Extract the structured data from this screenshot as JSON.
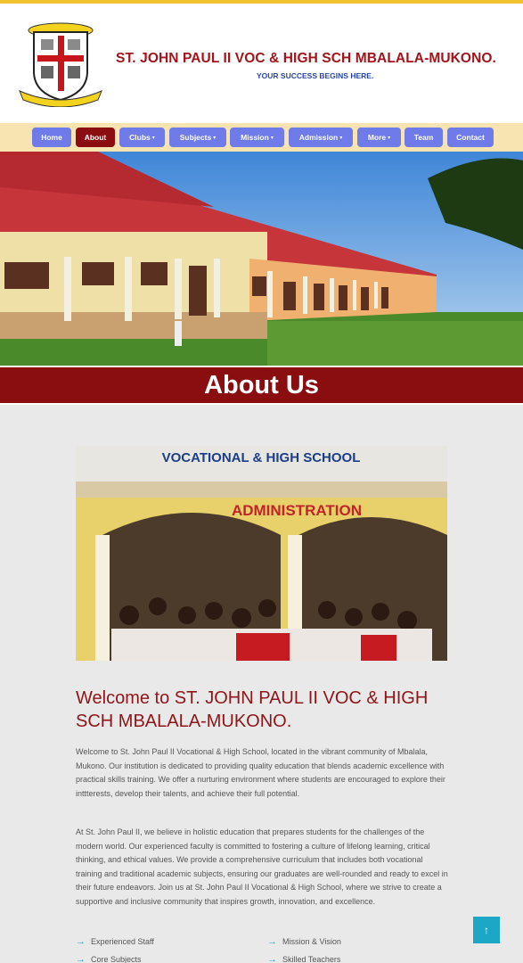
{
  "header": {
    "school_name": "ST. JOHN PAUL II VOC & HIGH SCH MBALALA-MUKONO.",
    "tagline": "YOUR SUCCESS BEGINS HERE.",
    "logo_icon": "school-crest-icon"
  },
  "nav": {
    "items": [
      {
        "label": "Home",
        "dropdown": false
      },
      {
        "label": "About",
        "dropdown": false,
        "active": true
      },
      {
        "label": "Clubs",
        "dropdown": true
      },
      {
        "label": "Subjects",
        "dropdown": true
      },
      {
        "label": "Mission",
        "dropdown": true
      },
      {
        "label": "Admission",
        "dropdown": true
      },
      {
        "label": "More",
        "dropdown": true
      },
      {
        "label": "Team",
        "dropdown": false
      },
      {
        "label": "Contact",
        "dropdown": false
      }
    ],
    "caret": "▾"
  },
  "about_band": {
    "title": "About Us"
  },
  "photo": {
    "sign_top": "VOCATIONAL & HIGH SCHOOL",
    "sign_bottom": "ADMINISTRATION"
  },
  "main": {
    "welcome_title": "Welcome to ST. JOHN PAUL II VOC & HIGH SCH MBALALA-MUKONO.",
    "paragraph1": "Welcome to St. John Paul II Vocational & High School, located in the vibrant community of Mbalala, Mukono. Our institution is dedicated to providing quality education that blends academic excellence with practical skills training. We offer a nurturing environment where students are encouraged to explore their inttterests, develop their talents, and achieve their full potential.",
    "paragraph2": "At St. John Paul II, we believe in holistic education that prepares students for the challenges of the modern world. Our experienced faculty is committed to fostering a culture of lifelong learning, critical thinking, and ethical values. We provide a comprehensive curriculum that includes both vocational training and traditional academic subjects, ensuring our graduates are well-rounded and ready to excel in their future endeavors. Join us at St. John Paul II Vocational & High School, where we strive to create a supportive and inclusive community that inspires growth, innovation, and excellence.",
    "features": [
      "Experienced Staff",
      "Mission & Vision",
      "Core Subjects",
      "Skilled Teachers"
    ],
    "feature_arrow": "→"
  },
  "scroll_top": {
    "icon": "arrow-up-icon",
    "glyph": "↑"
  },
  "colors": {
    "brand_red": "#8a0e10",
    "nav_blue": "#6e7be8",
    "nav_bar": "#f8e4b0",
    "accent_cyan": "#1ca7c6",
    "tagline_blue": "#2846a8"
  }
}
